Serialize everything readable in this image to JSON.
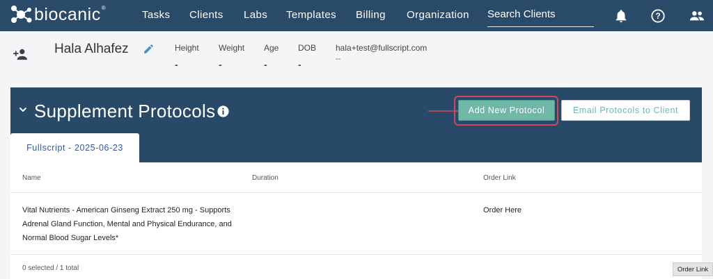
{
  "brand": {
    "name": "biocanic",
    "trademark": "®"
  },
  "nav": {
    "items": [
      "Tasks",
      "Clients",
      "Labs",
      "Templates",
      "Billing",
      "Organization"
    ],
    "search_placeholder": "Search Clients",
    "icons": [
      "bell-icon",
      "help-icon",
      "people-icon"
    ]
  },
  "client": {
    "name": "Hala Alhafez",
    "stats": [
      {
        "label": "Height",
        "value": "-"
      },
      {
        "label": "Weight",
        "value": "-"
      },
      {
        "label": "Age",
        "value": "-"
      },
      {
        "label": "DOB",
        "value": "-"
      }
    ],
    "email": "hala+test@fullscript.com",
    "email_sub": "--"
  },
  "protocols": {
    "title": "Supplement Protocols",
    "add_button": "Add New Protocol",
    "email_button": "Email Protocols to Client",
    "tab": "Fullscript - 2025-06-23"
  },
  "table": {
    "headers": [
      "Name",
      "Duration",
      "Order Link"
    ],
    "rows": [
      {
        "name": "Vital Nutrients - American Ginseng Extract 250 mg - Supports Adrenal Gland Function, Mental and Physical Endurance, and Normal Blood Sugar Levels*",
        "duration": "",
        "order_link": "Order Here"
      }
    ],
    "footer": "0 selected / 1 total"
  },
  "tooltip": "Order Link",
  "colors": {
    "nav_bg": "#2a4a69",
    "panel_bg": "#284a68",
    "accent_green": "#6fb8a8",
    "highlight_red": "#d0485a",
    "tab_text": "#2f57a4"
  }
}
